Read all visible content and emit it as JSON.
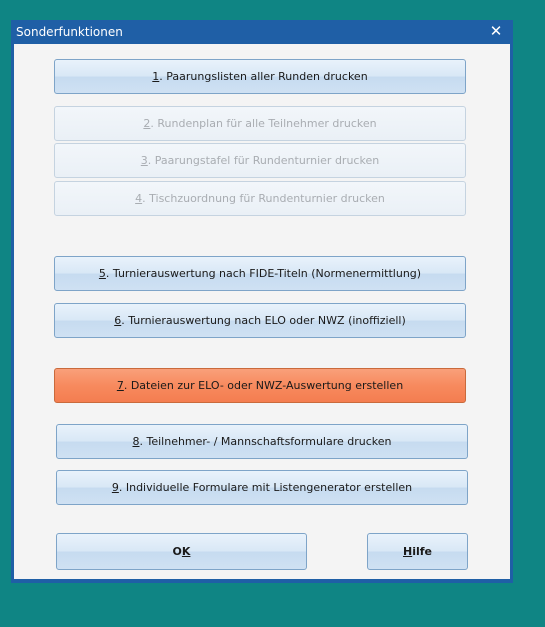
{
  "window": {
    "title": "Sonderfunktionen",
    "close_symbol": "✕"
  },
  "buttons": [
    {
      "key": "1",
      "label": ". Paarungslisten aller Runden drucken",
      "state": "enabled"
    },
    {
      "key": "2",
      "label": ". Rundenplan für alle Teilnehmer drucken",
      "state": "disabled"
    },
    {
      "key": "3",
      "label": ". Paarungstafel  für Rundenturnier drucken",
      "state": "disabled"
    },
    {
      "key": "4",
      "label": ". Tischzuordnung für Rundenturnier drucken",
      "state": "disabled"
    },
    {
      "key": "5",
      "label": ". Turnierauswertung nach FIDE-Titeln (Normenermittlung)",
      "state": "enabled"
    },
    {
      "key": "6",
      "label": ". Turnierauswertung nach ELO oder NWZ (inoffiziell)",
      "state": "enabled"
    },
    {
      "key": "7",
      "label": ". Dateien zur ELO- oder NWZ-Auswertung erstellen",
      "state": "highlighted"
    },
    {
      "key": "8",
      "label": ". Teilnehmer- / Mannschaftsformulare drucken",
      "state": "enabled"
    },
    {
      "key": "9",
      "label": ". Individuelle Formulare mit Listengenerator erstellen",
      "state": "enabled"
    }
  ],
  "ok": {
    "pre": "O",
    "key": "K",
    "post": ""
  },
  "help": {
    "pre": "",
    "key": "H",
    "post": "ilfe"
  },
  "colors": {
    "background": "#0f8584",
    "titlebar": "#1f5fa6",
    "accent": "#f78a5e"
  }
}
